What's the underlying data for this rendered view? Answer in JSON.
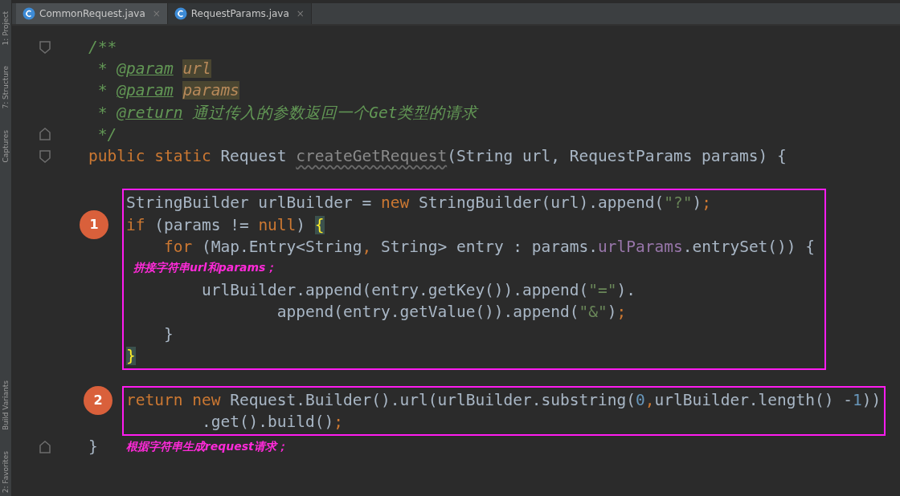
{
  "tabs": [
    {
      "label": "CommonRequest.java",
      "close": "×",
      "selected": true
    },
    {
      "label": "RequestParams.java",
      "close": "×",
      "selected": false
    }
  ],
  "tool_windows": {
    "top": [
      "1: Project",
      "7: Structure",
      "Captures"
    ],
    "bottom": [
      "Build Variants",
      "2: Favorites"
    ]
  },
  "code": [
    {
      "kind": "lines",
      "lines": [
        {
          "kind": "fold-start",
          "tokens": [
            {
              "kind": "comment",
              "text": "/**"
            }
          ]
        },
        {
          "kind": "code",
          "tokens": [
            {
              "kind": "comment",
              "text": " * "
            },
            {
              "kind": "doctag",
              "text": "@param"
            },
            {
              "kind": "paramref",
              "text": "url"
            }
          ]
        },
        {
          "kind": "code",
          "tokens": [
            {
              "kind": "comment",
              "text": " * "
            },
            {
              "kind": "doctag",
              "text": "@param"
            },
            {
              "kind": "paramref",
              "text": "params"
            }
          ]
        },
        {
          "kind": "code",
          "tokens": [
            {
              "kind": "comment",
              "text": " * "
            },
            {
              "kind": "doctag",
              "text": "@return"
            },
            {
              "kind": "comment",
              "text": " 通过传入的参数返回一个Get类型的请求"
            }
          ]
        },
        {
          "kind": "fold-end",
          "tokens": [
            {
              "kind": "comment",
              "text": " */"
            }
          ]
        },
        {
          "kind": "fold-start",
          "tokens": [
            {
              "kind": "keyword",
              "text": "public static "
            },
            {
              "kind": "plain",
              "text": "Request "
            },
            {
              "kind": "unused",
              "text": "createGetRequest"
            },
            {
              "kind": "plain",
              "text": "(String url, RequestParams params) {"
            }
          ]
        },
        {
          "kind": "code"
        }
      ]
    },
    {
      "kind": "boxed",
      "lines": [
        {
          "tokens": [
            {
              "kind": "plain",
              "text": "StringBuilder urlBuilder = "
            },
            {
              "kind": "keyword",
              "text": "new"
            },
            {
              "kind": "plain",
              "text": " StringBuilder(url).append("
            },
            {
              "kind": "string",
              "text": "\"?\""
            },
            {
              "kind": "plain",
              "text": ")"
            },
            {
              "kind": "keyword",
              "text": ";"
            }
          ]
        },
        {
          "badge": "1",
          "tokens": [
            {
              "kind": "keyword",
              "text": "if"
            },
            {
              "kind": "plain",
              "text": " (params != "
            },
            {
              "kind": "keyword",
              "text": "null"
            },
            {
              "kind": "plain",
              "text": ") "
            },
            {
              "kind": "brace",
              "text": "{"
            }
          ]
        },
        {
          "tokens": [
            {
              "kind": "keyword",
              "text": "    for"
            },
            {
              "kind": "plain",
              "text": " (Map.Entry<String"
            },
            {
              "kind": "keyword",
              "text": ","
            },
            {
              "kind": "plain",
              "text": " String> entry : params."
            },
            {
              "kind": "field",
              "text": "urlParams"
            },
            {
              "kind": "plain",
              "text": ".entrySet()) {"
            }
          ]
        },
        {
          "note": "拼接字符串url和params；"
        },
        {
          "tokens": [
            {
              "kind": "plain",
              "text": "        urlBuilder.append(entry.getKey()).append("
            },
            {
              "kind": "string",
              "text": "\"=\""
            },
            {
              "kind": "plain",
              "text": ")."
            }
          ]
        },
        {
          "tokens": [
            {
              "kind": "plain",
              "text": "                append(entry.getValue()).append("
            },
            {
              "kind": "string",
              "text": "\"&\""
            },
            {
              "kind": "plain",
              "text": ")"
            },
            {
              "kind": "keyword",
              "text": ";"
            }
          ]
        },
        {
          "tokens": [
            {
              "kind": "plain",
              "text": "    }"
            }
          ]
        },
        {
          "tokens": [
            {
              "kind": "brace",
              "text": "}"
            }
          ]
        }
      ]
    },
    {
      "kind": "boxed",
      "lines": [
        {
          "badge": "2",
          "tokens": [
            {
              "kind": "keyword",
              "text": "return new"
            },
            {
              "kind": "plain",
              "text": " Request.Builder().url(urlBuilder.substring("
            },
            {
              "kind": "number",
              "text": "0"
            },
            {
              "kind": "keyword",
              "text": ","
            },
            {
              "kind": "plain",
              "text": "urlBuilder.length() -"
            },
            {
              "kind": "number",
              "text": "1"
            },
            {
              "kind": "plain",
              "text": "))"
            }
          ]
        },
        {
          "tokens": [
            {
              "kind": "plain",
              "text": "        .get().build()"
            },
            {
              "kind": "keyword",
              "text": ";"
            }
          ]
        }
      ]
    },
    {
      "kind": "lines",
      "lines": [
        {
          "kind": "fold-end",
          "note": "根据字符串生成request请求；",
          "tokens": [
            {
              "kind": "plain",
              "text": "}"
            }
          ]
        }
      ]
    }
  ]
}
